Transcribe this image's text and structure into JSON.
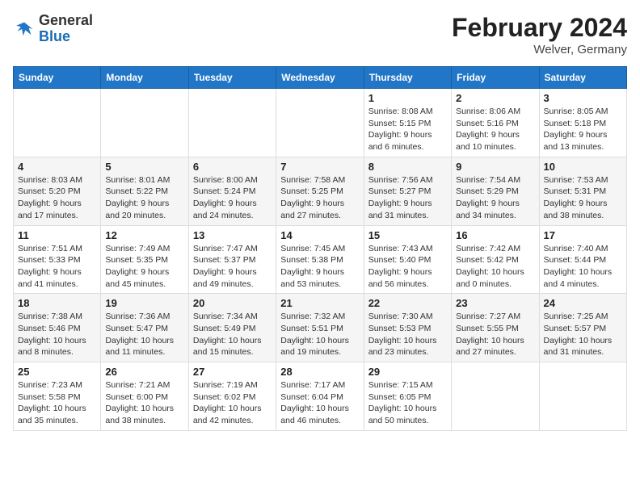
{
  "header": {
    "logo_general": "General",
    "logo_blue": "Blue",
    "month_year": "February 2024",
    "location": "Welver, Germany"
  },
  "days_of_week": [
    "Sunday",
    "Monday",
    "Tuesday",
    "Wednesday",
    "Thursday",
    "Friday",
    "Saturday"
  ],
  "weeks": [
    [
      {
        "day": "",
        "sunrise": "",
        "sunset": "",
        "daylight": ""
      },
      {
        "day": "",
        "sunrise": "",
        "sunset": "",
        "daylight": ""
      },
      {
        "day": "",
        "sunrise": "",
        "sunset": "",
        "daylight": ""
      },
      {
        "day": "",
        "sunrise": "",
        "sunset": "",
        "daylight": ""
      },
      {
        "day": "1",
        "sunrise": "Sunrise: 8:08 AM",
        "sunset": "Sunset: 5:15 PM",
        "daylight": "Daylight: 9 hours and 6 minutes."
      },
      {
        "day": "2",
        "sunrise": "Sunrise: 8:06 AM",
        "sunset": "Sunset: 5:16 PM",
        "daylight": "Daylight: 9 hours and 10 minutes."
      },
      {
        "day": "3",
        "sunrise": "Sunrise: 8:05 AM",
        "sunset": "Sunset: 5:18 PM",
        "daylight": "Daylight: 9 hours and 13 minutes."
      }
    ],
    [
      {
        "day": "4",
        "sunrise": "Sunrise: 8:03 AM",
        "sunset": "Sunset: 5:20 PM",
        "daylight": "Daylight: 9 hours and 17 minutes."
      },
      {
        "day": "5",
        "sunrise": "Sunrise: 8:01 AM",
        "sunset": "Sunset: 5:22 PM",
        "daylight": "Daylight: 9 hours and 20 minutes."
      },
      {
        "day": "6",
        "sunrise": "Sunrise: 8:00 AM",
        "sunset": "Sunset: 5:24 PM",
        "daylight": "Daylight: 9 hours and 24 minutes."
      },
      {
        "day": "7",
        "sunrise": "Sunrise: 7:58 AM",
        "sunset": "Sunset: 5:25 PM",
        "daylight": "Daylight: 9 hours and 27 minutes."
      },
      {
        "day": "8",
        "sunrise": "Sunrise: 7:56 AM",
        "sunset": "Sunset: 5:27 PM",
        "daylight": "Daylight: 9 hours and 31 minutes."
      },
      {
        "day": "9",
        "sunrise": "Sunrise: 7:54 AM",
        "sunset": "Sunset: 5:29 PM",
        "daylight": "Daylight: 9 hours and 34 minutes."
      },
      {
        "day": "10",
        "sunrise": "Sunrise: 7:53 AM",
        "sunset": "Sunset: 5:31 PM",
        "daylight": "Daylight: 9 hours and 38 minutes."
      }
    ],
    [
      {
        "day": "11",
        "sunrise": "Sunrise: 7:51 AM",
        "sunset": "Sunset: 5:33 PM",
        "daylight": "Daylight: 9 hours and 41 minutes."
      },
      {
        "day": "12",
        "sunrise": "Sunrise: 7:49 AM",
        "sunset": "Sunset: 5:35 PM",
        "daylight": "Daylight: 9 hours and 45 minutes."
      },
      {
        "day": "13",
        "sunrise": "Sunrise: 7:47 AM",
        "sunset": "Sunset: 5:37 PM",
        "daylight": "Daylight: 9 hours and 49 minutes."
      },
      {
        "day": "14",
        "sunrise": "Sunrise: 7:45 AM",
        "sunset": "Sunset: 5:38 PM",
        "daylight": "Daylight: 9 hours and 53 minutes."
      },
      {
        "day": "15",
        "sunrise": "Sunrise: 7:43 AM",
        "sunset": "Sunset: 5:40 PM",
        "daylight": "Daylight: 9 hours and 56 minutes."
      },
      {
        "day": "16",
        "sunrise": "Sunrise: 7:42 AM",
        "sunset": "Sunset: 5:42 PM",
        "daylight": "Daylight: 10 hours and 0 minutes."
      },
      {
        "day": "17",
        "sunrise": "Sunrise: 7:40 AM",
        "sunset": "Sunset: 5:44 PM",
        "daylight": "Daylight: 10 hours and 4 minutes."
      }
    ],
    [
      {
        "day": "18",
        "sunrise": "Sunrise: 7:38 AM",
        "sunset": "Sunset: 5:46 PM",
        "daylight": "Daylight: 10 hours and 8 minutes."
      },
      {
        "day": "19",
        "sunrise": "Sunrise: 7:36 AM",
        "sunset": "Sunset: 5:47 PM",
        "daylight": "Daylight: 10 hours and 11 minutes."
      },
      {
        "day": "20",
        "sunrise": "Sunrise: 7:34 AM",
        "sunset": "Sunset: 5:49 PM",
        "daylight": "Daylight: 10 hours and 15 minutes."
      },
      {
        "day": "21",
        "sunrise": "Sunrise: 7:32 AM",
        "sunset": "Sunset: 5:51 PM",
        "daylight": "Daylight: 10 hours and 19 minutes."
      },
      {
        "day": "22",
        "sunrise": "Sunrise: 7:30 AM",
        "sunset": "Sunset: 5:53 PM",
        "daylight": "Daylight: 10 hours and 23 minutes."
      },
      {
        "day": "23",
        "sunrise": "Sunrise: 7:27 AM",
        "sunset": "Sunset: 5:55 PM",
        "daylight": "Daylight: 10 hours and 27 minutes."
      },
      {
        "day": "24",
        "sunrise": "Sunrise: 7:25 AM",
        "sunset": "Sunset: 5:57 PM",
        "daylight": "Daylight: 10 hours and 31 minutes."
      }
    ],
    [
      {
        "day": "25",
        "sunrise": "Sunrise: 7:23 AM",
        "sunset": "Sunset: 5:58 PM",
        "daylight": "Daylight: 10 hours and 35 minutes."
      },
      {
        "day": "26",
        "sunrise": "Sunrise: 7:21 AM",
        "sunset": "Sunset: 6:00 PM",
        "daylight": "Daylight: 10 hours and 38 minutes."
      },
      {
        "day": "27",
        "sunrise": "Sunrise: 7:19 AM",
        "sunset": "Sunset: 6:02 PM",
        "daylight": "Daylight: 10 hours and 42 minutes."
      },
      {
        "day": "28",
        "sunrise": "Sunrise: 7:17 AM",
        "sunset": "Sunset: 6:04 PM",
        "daylight": "Daylight: 10 hours and 46 minutes."
      },
      {
        "day": "29",
        "sunrise": "Sunrise: 7:15 AM",
        "sunset": "Sunset: 6:05 PM",
        "daylight": "Daylight: 10 hours and 50 minutes."
      },
      {
        "day": "",
        "sunrise": "",
        "sunset": "",
        "daylight": ""
      },
      {
        "day": "",
        "sunrise": "",
        "sunset": "",
        "daylight": ""
      }
    ]
  ]
}
